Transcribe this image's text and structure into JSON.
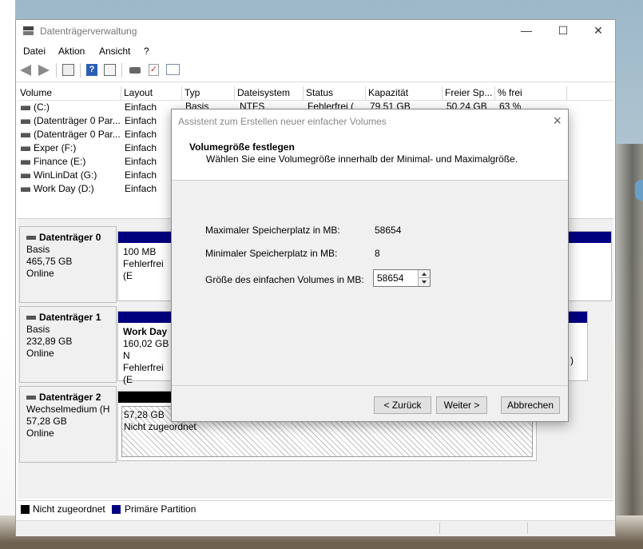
{
  "window": {
    "title": "Datenträgerverwaltung",
    "controls": {
      "minimize": "—",
      "maximize": "☐",
      "close": "✕"
    }
  },
  "menu": [
    "Datei",
    "Aktion",
    "Ansicht",
    "?"
  ],
  "toolbar_icons": [
    "back-arrow-icon",
    "forward-arrow-icon",
    "properties-icon",
    "help-icon",
    "console-icon",
    "connect-icon",
    "check-icon",
    "list-icon"
  ],
  "volume_table": {
    "columns": [
      "Volume",
      "Layout",
      "Typ",
      "Dateisystem",
      "Status",
      "Kapazität",
      "Freier Sp...",
      "% frei"
    ],
    "first_row_rest": {
      "typ": "Basis",
      "dateisystem": "NTFS",
      "status": "Fehlerfrei (",
      "kapazitaet": "79,51 GB",
      "frei": "50,24 GB",
      "prozent": "63 %"
    },
    "rows": [
      {
        "name": " (C:)",
        "layout": "Einfach"
      },
      {
        "name": "(Datenträger 0 Par...",
        "layout": "Einfach"
      },
      {
        "name": "(Datenträger 0 Par...",
        "layout": "Einfach"
      },
      {
        "name": "Exper (F:)",
        "layout": "Einfach"
      },
      {
        "name": "Finance (E:)",
        "layout": "Einfach"
      },
      {
        "name": "WinLinDat (G:)",
        "layout": "Einfach"
      },
      {
        "name": "Work Day (D:)",
        "layout": "Einfach"
      }
    ]
  },
  "disks": [
    {
      "name": "Datenträger 0",
      "type": "Basis",
      "size": "465,75 GB",
      "state": "Online",
      "part1": {
        "l1": "100 MB",
        "l2": "Fehlerfrei (E"
      }
    },
    {
      "name": "Datenträger 1",
      "type": "Basis",
      "size": "232,89 GB",
      "state": "Online",
      "part1": {
        "l1": "Work Day",
        "l2": "160,02 GB N",
        "l3": "Fehlerfrei (E"
      },
      "part_right_tail": ")"
    },
    {
      "name": "Datenträger 2",
      "type": "Wechselmedium (H",
      "size": "57,28 GB",
      "state": "Online",
      "part1": {
        "l1": "57,28 GB",
        "l2": "Nicht zugeordnet"
      }
    }
  ],
  "legend": [
    {
      "label": "Nicht zugeordnet",
      "color": "#000000"
    },
    {
      "label": "Primäre Partition",
      "color": "#000080"
    }
  ],
  "dialog": {
    "title": "Assistent zum Erstellen neuer einfacher Volumes",
    "heading": "Volumegröße festlegen",
    "subheading": "Wählen Sie eine Volumegröße innerhalb der Minimal- und Maximalgröße.",
    "max_label": "Maximaler Speicherplatz in MB:",
    "max_value": "58654",
    "min_label": "Minimaler Speicherplatz in MB:",
    "min_value": "8",
    "size_label": "Größe des einfachen Volumes in MB:",
    "size_value": "58654",
    "buttons": {
      "back": "< Zurück",
      "next": "Weiter >",
      "cancel": "Abbrechen"
    }
  }
}
